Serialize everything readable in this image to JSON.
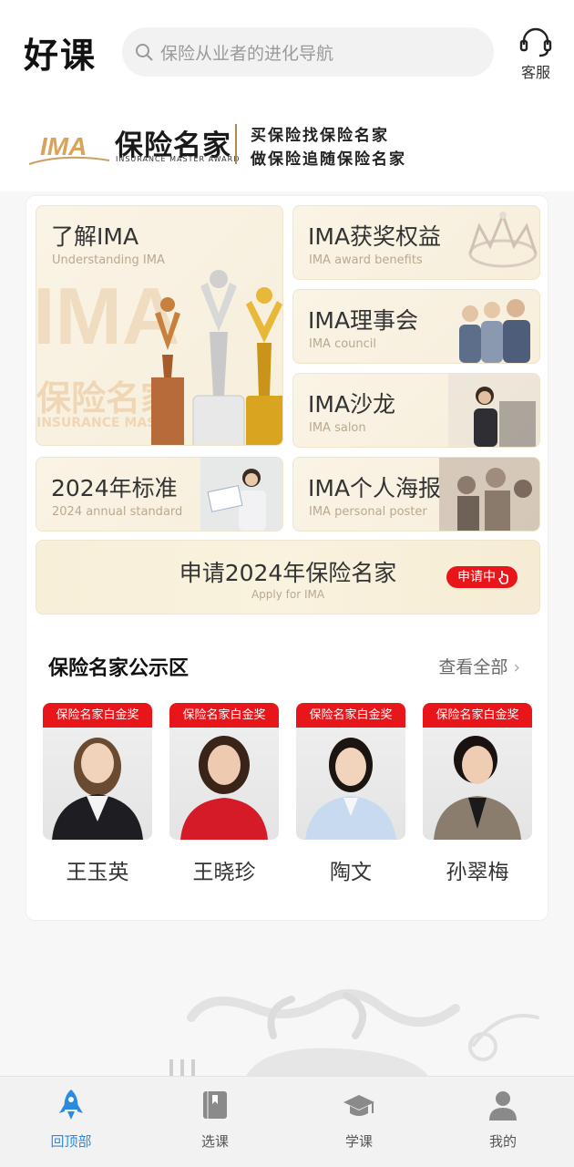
{
  "header": {
    "title": "好课",
    "search_placeholder": "保险从业者的进化导航",
    "service_label": "客服"
  },
  "banner": {
    "logo_text": "IMA",
    "brand_cn": "保险名家",
    "brand_en": "INSURANCE MASTER AWARD",
    "slogan_1": "买保险找保险名家",
    "slogan_2": "做保险追随保险名家"
  },
  "tiles": [
    {
      "title": "了解IMA",
      "subtitle": "Understanding IMA"
    },
    {
      "title": "IMA获奖权益",
      "subtitle": "IMA award benefits"
    },
    {
      "title": "IMA理事会",
      "subtitle": "IMA council"
    },
    {
      "title": "IMA沙龙",
      "subtitle": "IMA salon"
    },
    {
      "title": "2024年标准",
      "subtitle": "2024 annual standard"
    },
    {
      "title": "IMA个人海报",
      "subtitle": "IMA personal poster"
    }
  ],
  "tile_watermark": {
    "big": "IMA",
    "cn": "保险名家",
    "en": "INSURANCE MASTER"
  },
  "apply": {
    "title": "申请2024年保险名家",
    "subtitle": "Apply for IMA",
    "button": "申请中"
  },
  "showcase": {
    "title": "保险名家公示区",
    "view_all": "查看全部",
    "people": [
      {
        "badge": "保险名家白金奖",
        "name": "王玉英"
      },
      {
        "badge": "保险名家白金奖",
        "name": "王晓珍"
      },
      {
        "badge": "保险名家白金奖",
        "name": "陶文"
      },
      {
        "badge": "保险名家白金奖",
        "name": "孙翠梅"
      }
    ]
  },
  "tabbar": [
    {
      "label": "回顶部",
      "icon": "rocket-icon",
      "active": true
    },
    {
      "label": "选课",
      "icon": "book-icon",
      "active": false
    },
    {
      "label": "学课",
      "icon": "graduation-cap-icon",
      "active": false
    },
    {
      "label": "我的",
      "icon": "user-icon",
      "active": false
    }
  ],
  "colors": {
    "accent": "#2c8be0",
    "badge_red": "#e8151b",
    "gold": "#b08a4a"
  }
}
